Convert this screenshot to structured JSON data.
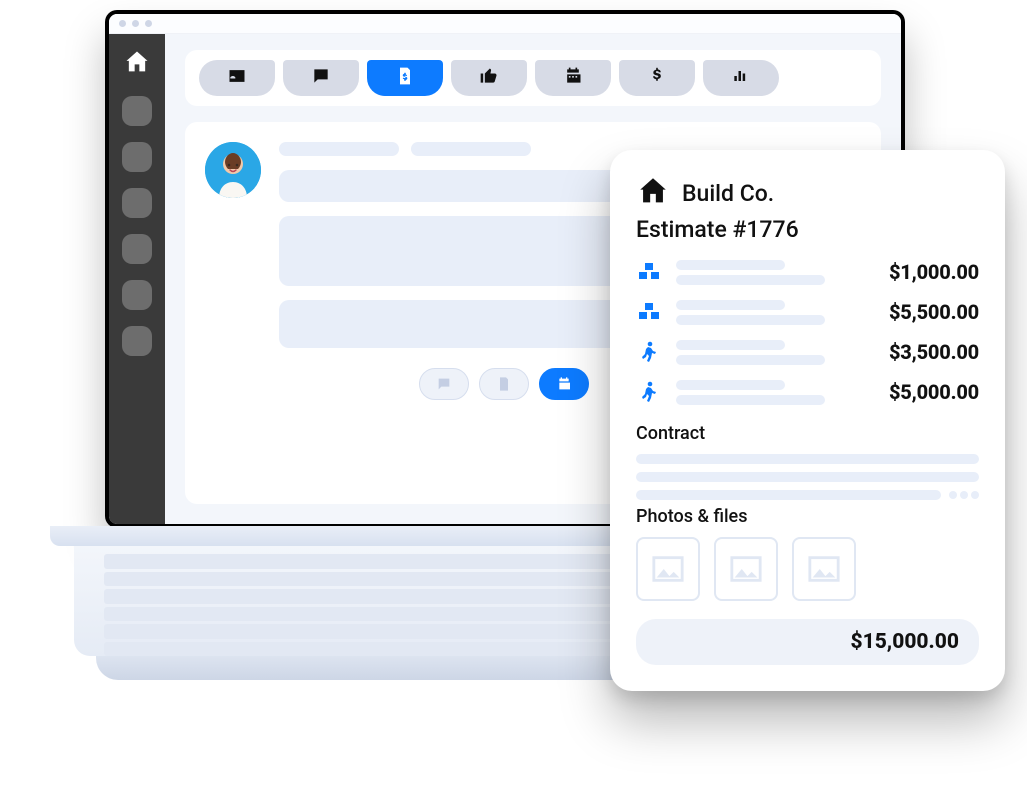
{
  "panel": {
    "company": "Build Co.",
    "estimate_label": "Estimate #1776",
    "contract_title": "Contract",
    "photos_title": "Photos & files",
    "total": "$15,000.00",
    "items": [
      {
        "icon": "boxes",
        "price": "$1,000.00"
      },
      {
        "icon": "boxes",
        "price": "$5,500.00"
      },
      {
        "icon": "person",
        "price": "$3,500.00"
      },
      {
        "icon": "person",
        "price": "$5,000.00"
      }
    ]
  },
  "tabs": [
    {
      "icon": "id-card"
    },
    {
      "icon": "chat"
    },
    {
      "icon": "document-money",
      "active": true
    },
    {
      "icon": "thumbs-up"
    },
    {
      "icon": "calendar"
    },
    {
      "icon": "dollar"
    },
    {
      "icon": "bar-chart"
    }
  ]
}
